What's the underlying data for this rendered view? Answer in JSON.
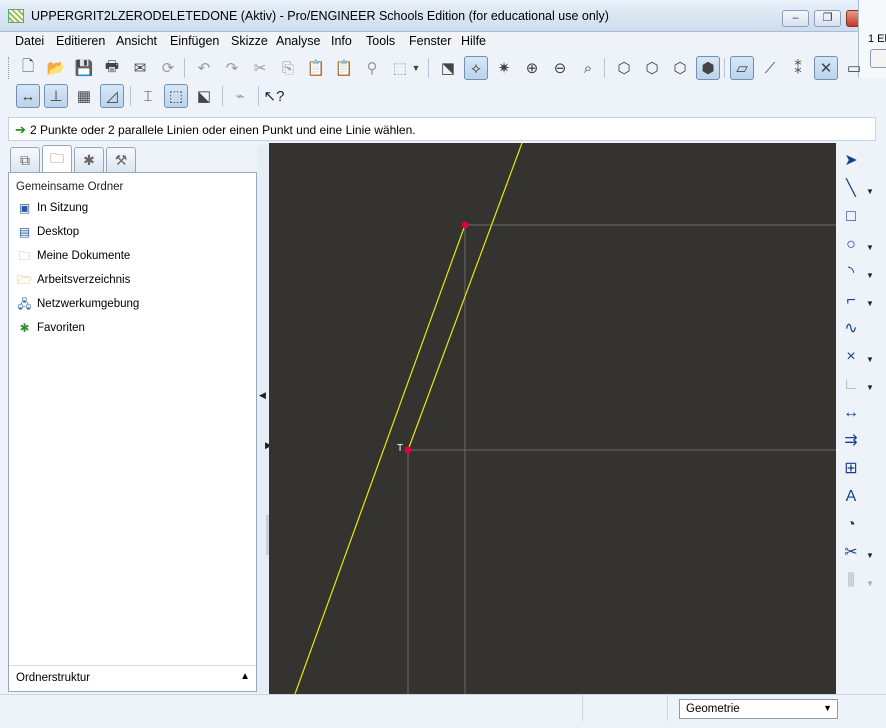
{
  "window": {
    "title": "UPPERGRIT2LZERODELETEDONE (Aktiv) - Pro/ENGINEER Schools Edition (for educational use only)",
    "minimize": "–",
    "restore": "❐",
    "close": "✕"
  },
  "menu": [
    "Datei",
    "Editieren",
    "Ansicht",
    "Einfügen",
    "Skizze",
    "Analyse",
    "Info",
    "Tools",
    "Fenster",
    "Hilfe"
  ],
  "message": "2 Punkte oder 2 parallele Linien oder einen Punkt und eine Linie wählen.",
  "navigator": {
    "header": "Gemeinsame Ordner",
    "folders": [
      "In Sitzung",
      "Desktop",
      "Meine Dokumente",
      "Arbeitsverzeichnis",
      "Netzwerkumgebung",
      "Favoriten"
    ],
    "footer": "Ordnerstruktur"
  },
  "sketch": {
    "vertex_label": "T",
    "line_color": "#e8e800",
    "point_color": "#e0003a",
    "ref_line_color": "#6b6b6b",
    "background": "#343330"
  },
  "peek": {
    "text": "1 El"
  },
  "status": {
    "filter": "Geometrie"
  }
}
